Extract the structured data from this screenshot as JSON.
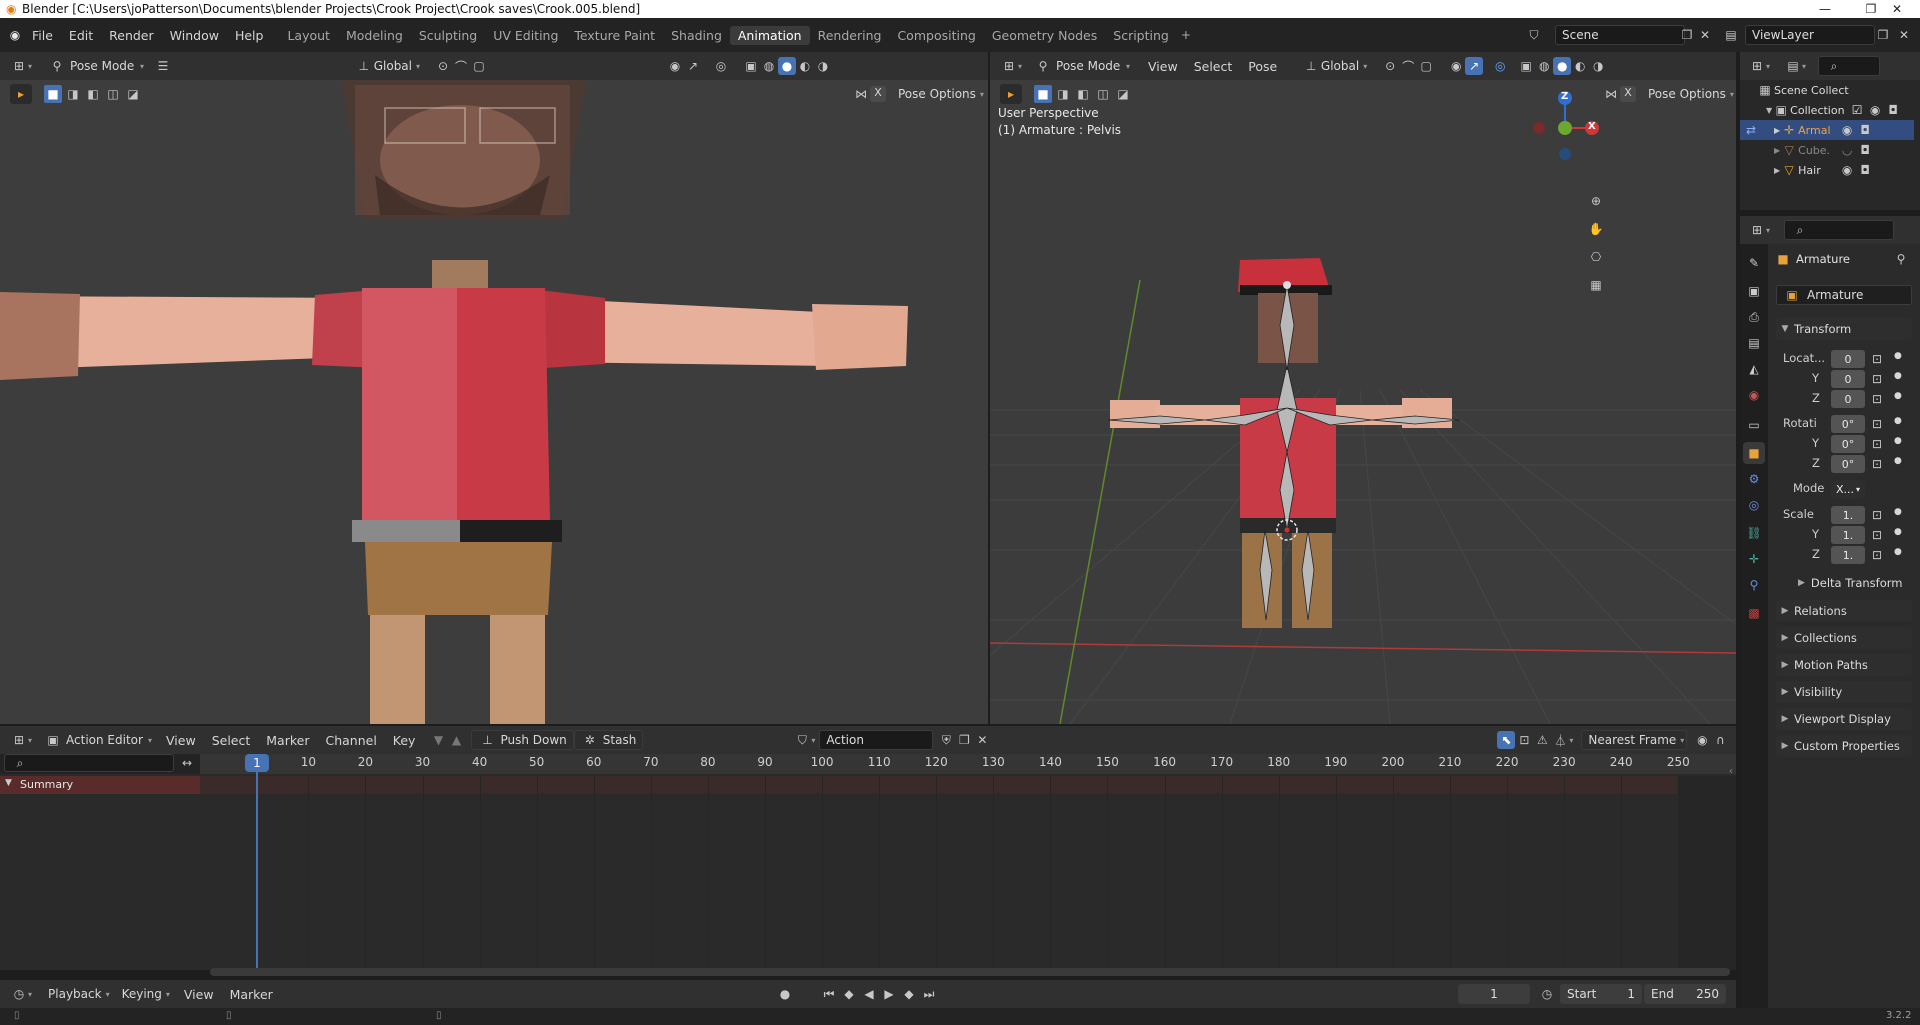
{
  "app": {
    "title": "Blender [C:\\Users\\joPatterson\\Documents\\blender Projects\\Crook Project\\Crook saves\\Crook.005.blend]",
    "version": "3.2.2"
  },
  "menus": [
    "File",
    "Edit",
    "Render",
    "Window",
    "Help"
  ],
  "workspace_tabs": [
    "Layout",
    "Modeling",
    "Sculpting",
    "UV Editing",
    "Texture Paint",
    "Shading",
    "Animation",
    "Rendering",
    "Compositing",
    "Geometry Nodes",
    "Scripting"
  ],
  "active_workspace": "Animation",
  "scene": {
    "name": "Scene",
    "view_layer": "ViewLayer"
  },
  "viewport_left": {
    "mode": "Pose Mode",
    "orientation": "Global",
    "options_label": "Pose Options",
    "x_label": "X"
  },
  "viewport_right": {
    "mode": "Pose Mode",
    "menus": [
      "View",
      "Select",
      "Pose"
    ],
    "orientation": "Global",
    "options_label": "Pose Options",
    "x_label": "X",
    "overlay_line1": "User Perspective",
    "overlay_line2": "(1) Armature : Pelvis",
    "gizmo": {
      "z": "Z",
      "x": "X"
    }
  },
  "outliner": {
    "root": "Scene Collect",
    "collection": "Collection",
    "items": [
      {
        "name": "Armal",
        "selected": true
      },
      {
        "name": "Cube.",
        "selected": false
      },
      {
        "name": "Hair",
        "selected": false
      }
    ]
  },
  "properties": {
    "object_name": "Armature",
    "data_name": "Armature",
    "transform_label": "Transform",
    "location_label": "Locat...",
    "rotation_label": "Rotati",
    "scale_label": "Scale",
    "axis_y": "Y",
    "axis_z": "Z",
    "location": [
      "0",
      "0",
      "0"
    ],
    "rotation": [
      "0°",
      "0°",
      "0°"
    ],
    "mode_label": "Mode",
    "mode_value": "X...",
    "scale": [
      "1.",
      "1.",
      "1."
    ],
    "delta_transform": "Delta Transform",
    "panels": [
      "Relations",
      "Collections",
      "Motion Paths",
      "Visibility",
      "Viewport Display",
      "Custom Properties"
    ]
  },
  "action_editor": {
    "editor_type": "Action Editor",
    "menus": [
      "View",
      "Select",
      "Marker",
      "Channel",
      "Key"
    ],
    "push_down": "Push Down",
    "stash": "Stash",
    "action_name": "Action",
    "snap_mode": "Nearest Frame",
    "current_frame_marker": "1",
    "ticks": [
      "10",
      "20",
      "30",
      "40",
      "50",
      "60",
      "70",
      "80",
      "90",
      "100",
      "110",
      "120",
      "130",
      "140",
      "150",
      "160",
      "170",
      "180",
      "190",
      "200",
      "210",
      "220",
      "230",
      "240",
      "250"
    ],
    "summary_label": "Summary"
  },
  "timeline_footer": {
    "menus": [
      "Playback",
      "Keying",
      "View",
      "Marker"
    ],
    "current_frame": "1",
    "start_label": "Start",
    "start_value": "1",
    "end_label": "End",
    "end_value": "250"
  },
  "colors": {
    "accent_blue": "#4772b3",
    "object_orange": "#e8a23c",
    "shirt_red": "#c5303d",
    "skin": "#e8b49c",
    "pants": "#a2764c"
  },
  "icons": [
    "blender-logo-icon",
    "hamburger-icon",
    "eye-icon",
    "camera-icon",
    "hand-icon",
    "zoom-icon",
    "grid-icon",
    "search-icon",
    "play-icon",
    "record-icon",
    "filter-icon",
    "pin-icon"
  ]
}
